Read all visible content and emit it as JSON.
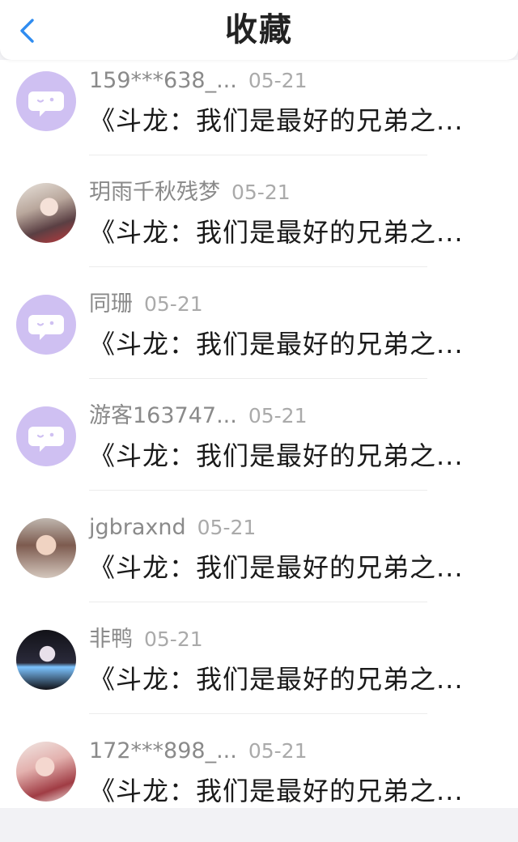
{
  "header": {
    "title": "收藏"
  },
  "items": [
    {
      "username": "159***638_...",
      "date": "05-21",
      "title": "《斗龙：我们是最好的兄弟之...",
      "avatar": "default"
    },
    {
      "username": "玥雨千秋残梦",
      "date": "05-21",
      "title": "《斗龙：我们是最好的兄弟之...",
      "avatar": "photo"
    },
    {
      "username": "同珊",
      "date": "05-21",
      "title": "《斗龙：我们是最好的兄弟之...",
      "avatar": "default"
    },
    {
      "username": "游客163747...",
      "date": "05-21",
      "title": "《斗龙：我们是最好的兄弟之...",
      "avatar": "default"
    },
    {
      "username": "jgbraxnd",
      "date": "05-21",
      "title": "《斗龙：我们是最好的兄弟之...",
      "avatar": "photo"
    },
    {
      "username": "非鸭",
      "date": "05-21",
      "title": "《斗龙：我们是最好的兄弟之...",
      "avatar": "photo"
    },
    {
      "username": "172***898_...",
      "date": "05-21",
      "title": "《斗龙：我们是最好的兄弟之...",
      "avatar": "photo"
    }
  ],
  "colors": {
    "accent": "#2f8cf0",
    "default_avatar": "#cfc0f2"
  }
}
